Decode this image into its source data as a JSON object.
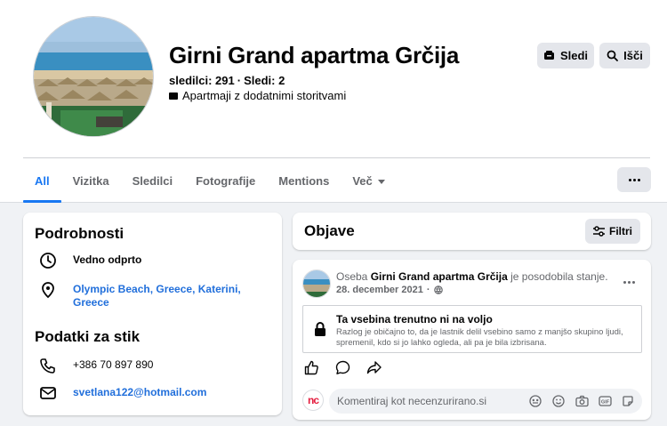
{
  "page": {
    "title": "Girni Grand apartma Grčija",
    "followers": "sledilci: 291",
    "following": "Sledi: 2",
    "stats_separator": "·",
    "category": "Apartmaji z dodatnimi storitvami",
    "follow_label": "Sledi",
    "search_label": "Išči"
  },
  "tabs": [
    {
      "label": "All",
      "active": true
    },
    {
      "label": "Vizitka"
    },
    {
      "label": "Sledilci"
    },
    {
      "label": "Fotografije"
    },
    {
      "label": "Mentions"
    },
    {
      "label": "Več"
    }
  ],
  "details": {
    "heading": "Podrobnosti",
    "hours": "Vedno odprto",
    "address": "Olympic Beach, Greece, Katerini, Greece",
    "contact_heading": "Podatki za stik",
    "phone": "+386 70 897 890",
    "email": "svetlana122@hotmail.com"
  },
  "posts": {
    "heading": "Objave",
    "filter_label": "Filtri",
    "post": {
      "prefix": "Oseba",
      "author": "Girni Grand apartma Grčija",
      "action": "je posodobila stanje.",
      "date": "28. december 2021",
      "date_separator": "·",
      "unavailable_title": "Ta vsebina trenutno ni na voljo",
      "unavailable_text": "Razlog je običajno to, da je lastnik delil vsebino samo z manjšo skupino ljudi, spremenil, kdo si jo lahko ogleda, ali pa je bila izbrisana.",
      "comment_placeholder": "Komentiraj kot necenzurirano.si",
      "commenter_initials": "nc"
    }
  },
  "colors": {
    "accent": "#1877f2",
    "link": "#216fdb"
  }
}
